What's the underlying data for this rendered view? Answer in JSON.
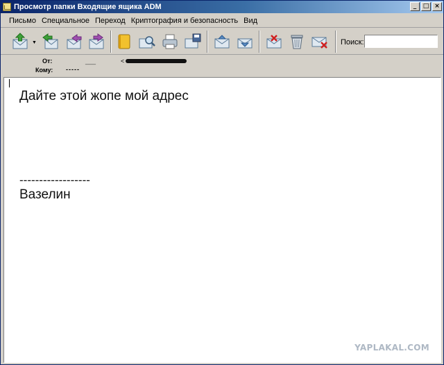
{
  "window": {
    "title": "Просмотр папки Входящие ящика ADM",
    "minimize_glyph": "_",
    "maximize_glyph": "□",
    "close_glyph": "×"
  },
  "menu": [
    {
      "label": "Письмо"
    },
    {
      "label": "Специальное"
    },
    {
      "label": "Переход"
    },
    {
      "label": "Криптография и безопасность"
    },
    {
      "label": "Вид"
    }
  ],
  "toolbar": {
    "dropdown_glyph": "▼",
    "icons": [
      "get-mail-icon",
      "reply-icon",
      "reply-all-icon",
      "forward-icon",
      "address-book-icon",
      "find-icon",
      "print-icon",
      "save-icon",
      "previous-message-icon",
      "next-message-icon",
      "delete-message-icon",
      "trash-icon",
      "mark-spam-icon"
    ],
    "search": {
      "label": "Поиск:",
      "value": ""
    }
  },
  "headers": {
    "from_label": "От:",
    "from_value": "<",
    "to_label": "Кому:",
    "to_value": "-----"
  },
  "message": {
    "lines": [
      "Дайте этой жопе мой адрес",
      "------------------",
      "Вазелин"
    ]
  },
  "watermark": "YAPLAKAL.COM",
  "colors": {
    "titlebar_start": "#0a246a",
    "titlebar_end": "#a6caf0",
    "chrome": "#d4d0c8",
    "body_bg": "#ffffff"
  }
}
